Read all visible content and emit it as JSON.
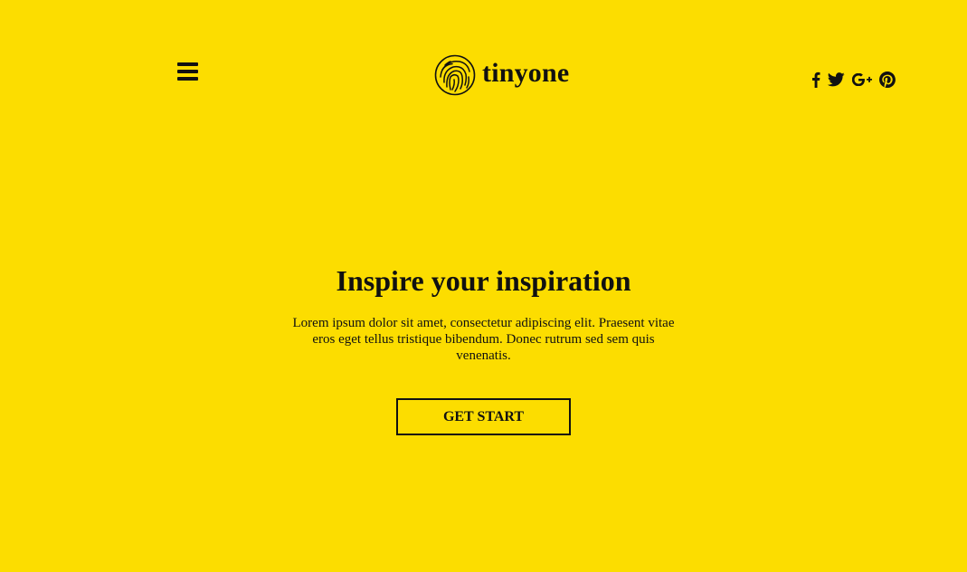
{
  "colors": {
    "background": "#FCDD00",
    "foreground": "#111111"
  },
  "header": {
    "menu_icon": "hamburger-icon",
    "brand": {
      "logo_icon": "fingerprint-icon",
      "name": "tinyone"
    },
    "social": [
      {
        "icon": "facebook-icon"
      },
      {
        "icon": "twitter-icon"
      },
      {
        "icon": "google-plus-icon"
      },
      {
        "icon": "pinterest-icon"
      }
    ]
  },
  "hero": {
    "title": "Inspire your inspiration",
    "description": "Lorem ipsum dolor sit amet, consectetur adipiscing elit. Praesent vitae eros eget tellus tristique bibendum. Donec rutrum sed sem quis venenatis.",
    "cta_label": "GET START"
  }
}
